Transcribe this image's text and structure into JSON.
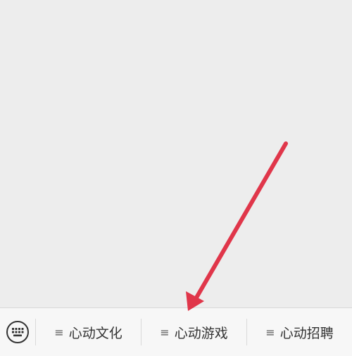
{
  "menu": {
    "keyboard_icon": "keyboard-icon",
    "items": [
      {
        "icon": "menu-lines-icon",
        "glyph": "≡",
        "label": "心动文化"
      },
      {
        "icon": "menu-lines-icon",
        "glyph": "≡",
        "label": "心动游戏"
      },
      {
        "icon": "menu-lines-icon",
        "glyph": "≡",
        "label": "心动招聘"
      }
    ]
  },
  "annotation": {
    "arrow_color": "#e0364a"
  },
  "colors": {
    "background": "#ededed",
    "menu_bar": "#f7f7f7",
    "menu_text": "#333333"
  }
}
